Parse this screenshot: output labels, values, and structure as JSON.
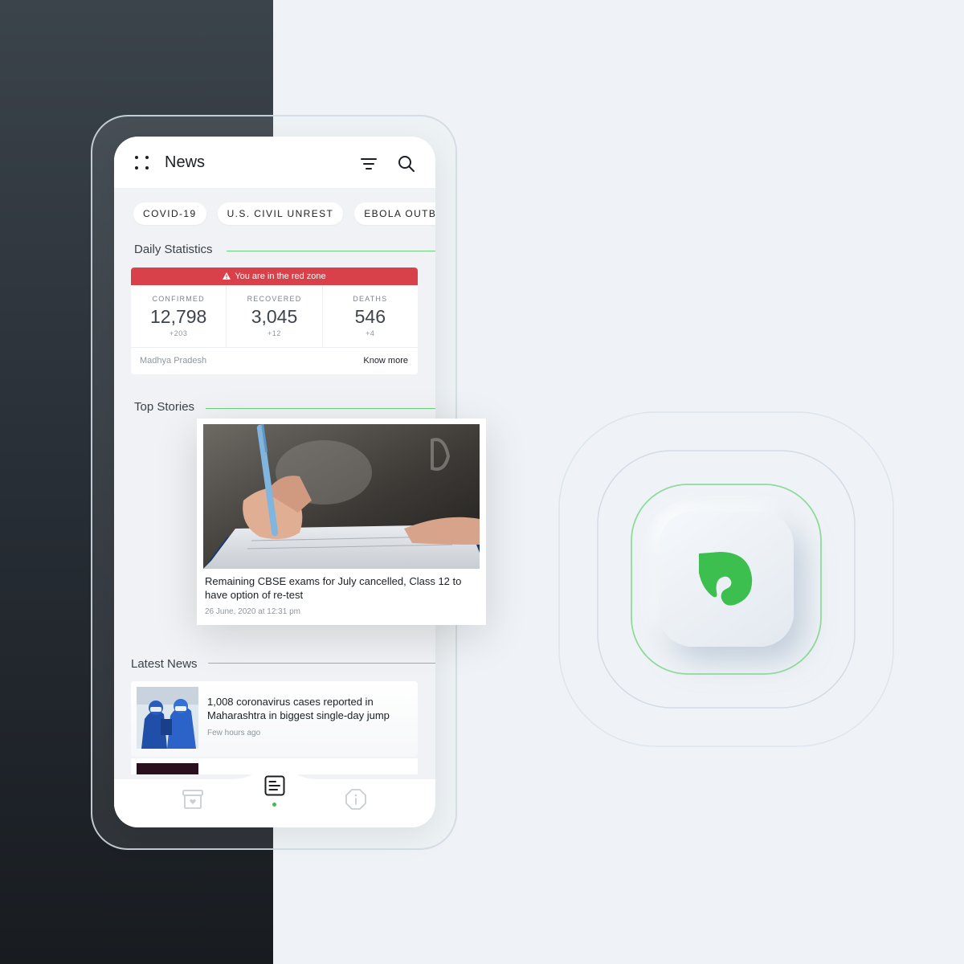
{
  "app": {
    "title": "News",
    "menu_icon": "dots-grid-icon",
    "filter_icon": "filter-icon",
    "search_icon": "search-icon"
  },
  "topics": [
    "COVID-19",
    "U.S. CIVIL UNREST",
    "EBOLA OUTBREA"
  ],
  "daily_statistics": {
    "section_title": "Daily Statistics",
    "alert": "You are in the red zone",
    "stats": [
      {
        "label": "CONFIRMED",
        "value": "12,798",
        "delta": "+203"
      },
      {
        "label": "RECOVERED",
        "value": "3,045",
        "delta": "+12"
      },
      {
        "label": "DEATHS",
        "value": "546",
        "delta": "+4"
      }
    ],
    "region": "Madhya Pradesh",
    "know_more": "Know more"
  },
  "top_stories": {
    "section_title": "Top Stories",
    "story": {
      "title": "Remaining CBSE exams for July cancelled, Class 12 to have option of re-test",
      "time": "26 June, 2020 at 12:31 pm"
    }
  },
  "latest_news": {
    "section_title": "Latest News",
    "items": [
      {
        "title": "1,008 coronavirus cases reported in Maharashtra in biggest single-day jump",
        "time": "Few hours ago"
      }
    ]
  },
  "bottom_nav": [
    {
      "icon": "saved-box-icon",
      "active": false
    },
    {
      "icon": "news-icon",
      "active": true
    },
    {
      "icon": "info-icon",
      "active": false
    }
  ],
  "colors": {
    "accent_green": "#3cbf4f",
    "alert_red": "#d9414a",
    "dark_background": "#262c33",
    "light_background": "#eff3f7"
  }
}
